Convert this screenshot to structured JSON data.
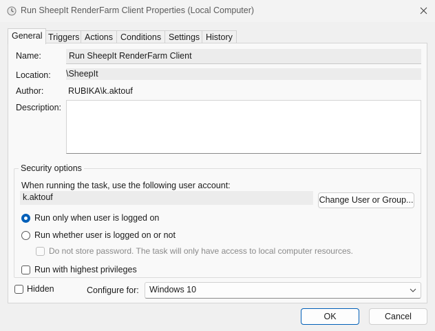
{
  "window": {
    "title": "Run SheepIt RenderFarm Client Properties (Local Computer)",
    "icons": {
      "app": "clock-icon",
      "close": "close-icon"
    }
  },
  "tabs": [
    {
      "label": "General",
      "selected": true
    },
    {
      "label": "Triggers",
      "selected": false
    },
    {
      "label": "Actions",
      "selected": false
    },
    {
      "label": "Conditions",
      "selected": false
    },
    {
      "label": "Settings",
      "selected": false
    },
    {
      "label": "History",
      "selected": false
    }
  ],
  "general": {
    "name_label": "Name:",
    "name_value": "Run SheepIt RenderFarm Client",
    "location_label": "Location:",
    "location_value": "\\SheepIt",
    "author_label": "Author:",
    "author_value": "RUBIKA\\k.aktouf",
    "description_label": "Description:",
    "description_value": ""
  },
  "security": {
    "title": "Security options",
    "account_prompt": "When running the task, use the following user account:",
    "account_value": "k.aktouf",
    "change_button": "Change User or Group...",
    "option_logged_on": {
      "label": "Run only when user is logged on",
      "selected": true
    },
    "option_whether": {
      "label": "Run whether user is logged on or not",
      "selected": false
    },
    "do_not_store": {
      "label": "Do not store password.  The task will only have access to local computer resources.",
      "checked": false,
      "enabled": false
    },
    "highest_privileges": {
      "label": "Run with highest privileges",
      "checked": false
    }
  },
  "footer": {
    "hidden": {
      "label": "Hidden",
      "checked": false
    },
    "configure_label": "Configure for:",
    "configure_value": "Windows 10"
  },
  "buttons": {
    "ok": "OK",
    "cancel": "Cancel"
  },
  "colors": {
    "accent": "#005fb8",
    "window_bg": "#f0f0f0",
    "panel_bg": "#f9f9f9"
  }
}
